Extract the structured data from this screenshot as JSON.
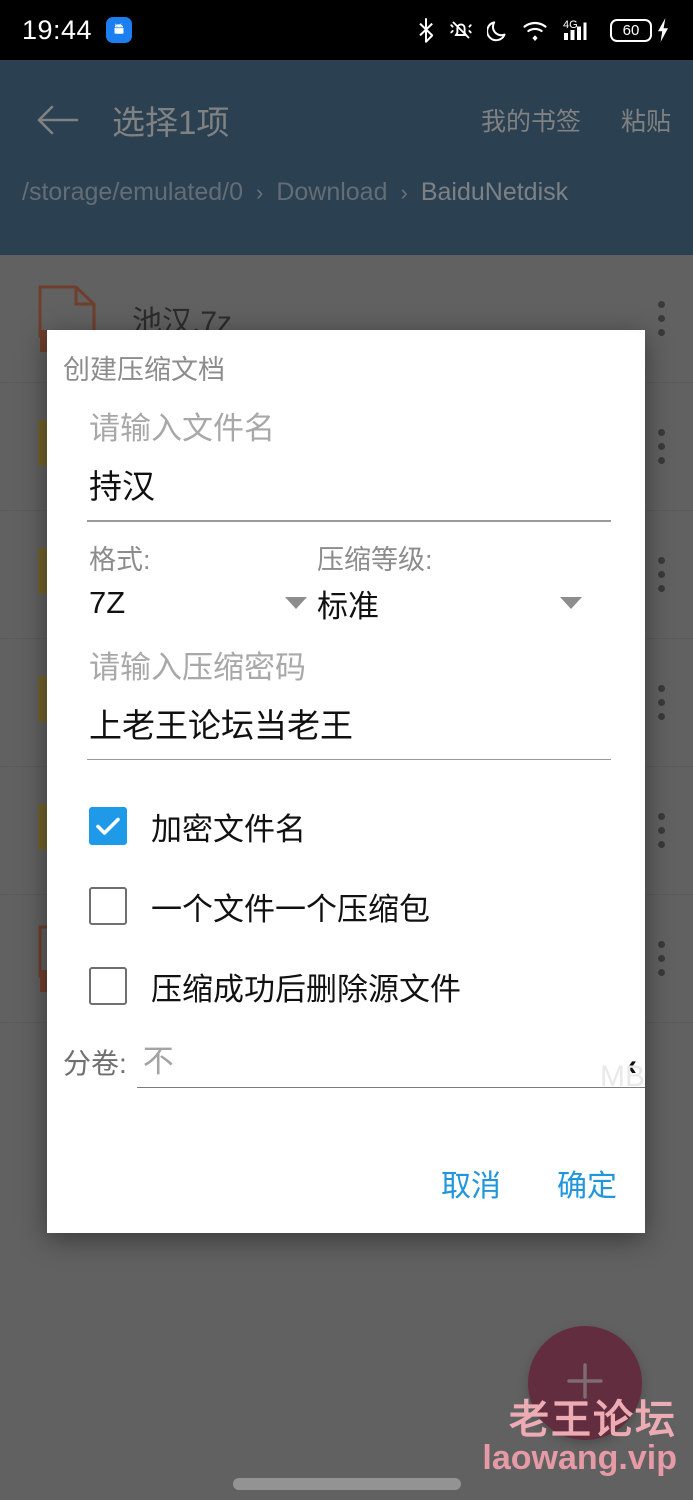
{
  "status_bar": {
    "time": "19:44",
    "notification_icon": "android-app-icon",
    "icons": [
      "bluetooth-icon",
      "vibrate-mute-icon",
      "do-not-disturb-moon-icon",
      "wifi-icon",
      "signal-4g-icon"
    ],
    "battery_level": "60",
    "battery_charging_icon": "charging-bolt-icon"
  },
  "app_bar": {
    "back_icon": "back-arrow-icon",
    "title": "选择1项",
    "actions": [
      {
        "label": "我的书签",
        "name": "my-bookmarks-action"
      },
      {
        "label": "粘贴",
        "name": "paste-action"
      }
    ],
    "breadcrumb": [
      {
        "label": "/storage/emulated/0",
        "current": false
      },
      {
        "label": "Download",
        "current": false
      },
      {
        "label": "BaiduNetdisk",
        "current": true
      }
    ],
    "breadcrumb_separator": "›",
    "background_color": "#1a4568"
  },
  "file_list": {
    "rows": [
      {
        "name": "池汉.7z",
        "icon": "archive-7z-file-icon",
        "icon_kind": "archive"
      },
      {
        "name": "",
        "icon": "folder-icon",
        "icon_kind": "folder"
      },
      {
        "name": "",
        "icon": "folder-icon",
        "icon_kind": "folder"
      },
      {
        "name": "",
        "icon": "folder-icon",
        "icon_kind": "folder"
      },
      {
        "name": "",
        "icon": "folder-icon",
        "icon_kind": "folder"
      },
      {
        "name": "",
        "icon": "archive-7z-file-icon",
        "icon_kind": "archive"
      }
    ],
    "overflow_icon": "three-dot-overflow-icon"
  },
  "fab": {
    "icon": "plus-icon",
    "color": "#8d1f41"
  },
  "watermark": {
    "line1": "老王论坛",
    "line2": "laowang.vip",
    "color": "#edabb4"
  },
  "dialog": {
    "title": "创建压缩文档",
    "filename": {
      "placeholder": "请输入文件名",
      "value": "持汉"
    },
    "format": {
      "label": "格式:",
      "value": "7Z",
      "caret_icon": "chevron-down-icon"
    },
    "level": {
      "label": "压缩等级:",
      "value": "标准",
      "caret_icon": "chevron-down-icon"
    },
    "password": {
      "placeholder": "请输入压缩密码",
      "value": "上老王论坛当老王"
    },
    "checkboxes": [
      {
        "label": "加密文件名",
        "checked": true
      },
      {
        "label": "一个文件一个压缩包",
        "checked": false
      },
      {
        "label": "压缩成功后删除源文件",
        "checked": false
      }
    ],
    "split": {
      "label": "分卷:",
      "value": "不",
      "chevron_icon": "chevron-left-icon",
      "unit": "MB"
    },
    "buttons": {
      "cancel": "取消",
      "confirm": "确定",
      "color": "#2196dd"
    }
  }
}
